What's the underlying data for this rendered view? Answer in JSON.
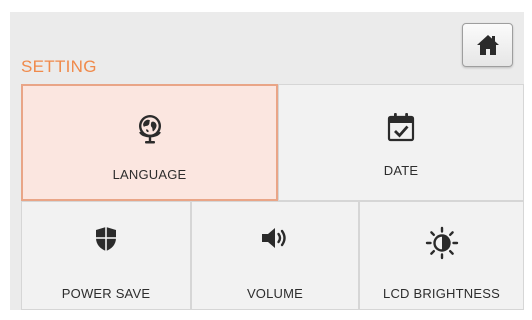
{
  "header": {
    "title": "SETTING",
    "home_icon": "home-icon"
  },
  "tiles": [
    {
      "label": "LANGUAGE",
      "icon": "globe-icon",
      "selected": true
    },
    {
      "label": "DATE",
      "icon": "calendar-check-icon",
      "selected": false
    },
    {
      "label": "POWER SAVE",
      "icon": "shield-icon",
      "selected": false
    },
    {
      "label": "VOLUME",
      "icon": "speaker-icon",
      "selected": false
    },
    {
      "label": "LCD BRIGHTNESS",
      "icon": "brightness-icon",
      "selected": false
    }
  ],
  "colors": {
    "accent": "#f08a4b",
    "selected_bg": "#fbe6e0",
    "selected_border": "#e9a587",
    "panel_bg": "#ebebeb",
    "tile_bg": "#f2f2f2",
    "icon": "#2b2b2b"
  }
}
